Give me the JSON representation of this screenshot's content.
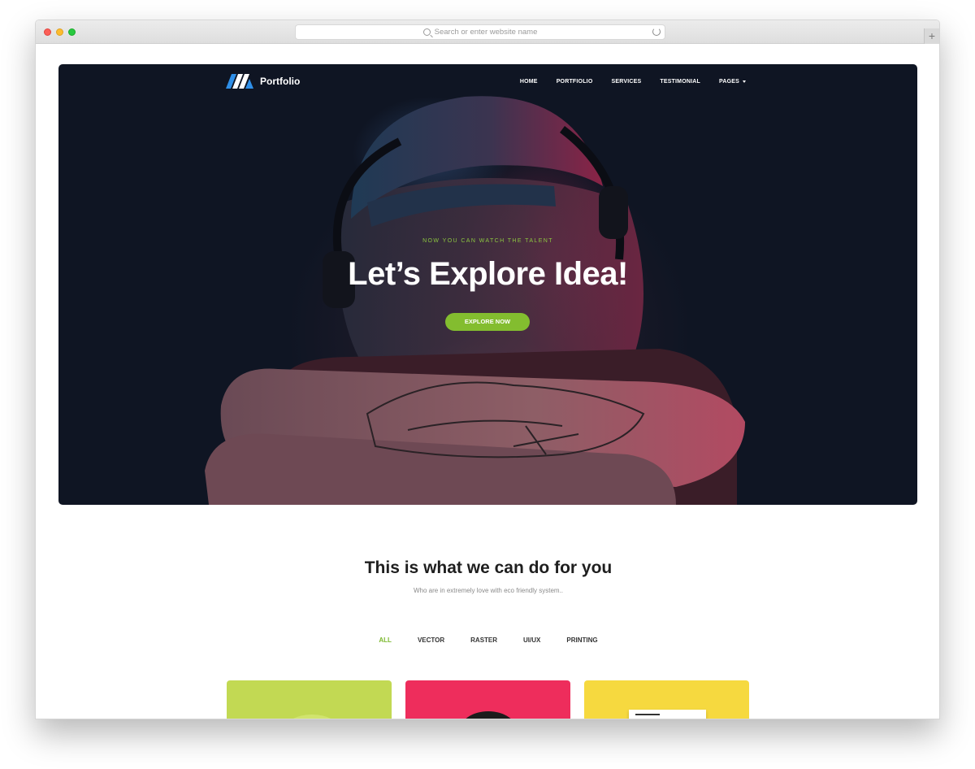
{
  "browser": {
    "url_placeholder": "Search or enter website name",
    "new_tab_symbol": "+",
    "icons": [
      "close-window-icon",
      "minimize-window-icon",
      "zoom-window-icon",
      "search-icon",
      "reload-icon",
      "new-tab-icon"
    ]
  },
  "site": {
    "brand": "Portfolio",
    "nav": {
      "home": "HOME",
      "portfolio": "PORTFIOLIO",
      "services": "SERVICES",
      "testimonial": "TESTIMONIAL",
      "pages": "PAGES"
    },
    "hero": {
      "eyebrow": "NOW YOU CAN WATCH THE TALENT",
      "headline": "Let’s Explore Idea!",
      "cta": "EXPLORE NOW"
    },
    "services": {
      "title": "This is what we can do for you",
      "subtitle": "Who are in extremely love with eco friendly system..",
      "filters": {
        "all": "ALL",
        "vector": "VECTOR",
        "raster": "RASTER",
        "uiux": "UI/UX",
        "printing": "PRINTING"
      },
      "active_filter": "ALL"
    }
  },
  "colors": {
    "accent": "#7cb82f",
    "button": "#83bd2f",
    "hero_bg": "#0f1523",
    "card_1": "#c2d953",
    "card_2": "#ee2d5c",
    "card_3": "#f6d93f"
  }
}
